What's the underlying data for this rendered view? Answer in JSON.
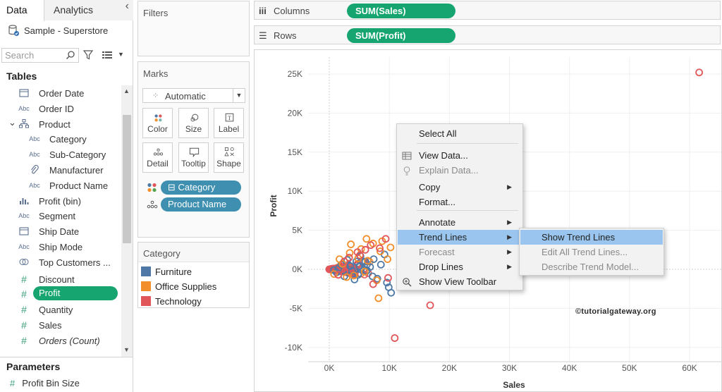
{
  "left_pane": {
    "tabs": {
      "data": "Data",
      "analytics": "Analytics"
    },
    "collapse_glyph": "‹",
    "datasource": "Sample - Superstore",
    "search": {
      "placeholder": "Search"
    },
    "tables_title": "Tables",
    "fields": [
      {
        "icon": "calendar-icon",
        "label": "Order Date"
      },
      {
        "icon": "abc-icon",
        "label": "Order ID"
      },
      {
        "icon": "hierarchy-icon",
        "label": "Product"
      },
      {
        "icon": "abc-icon",
        "label": "Category"
      },
      {
        "icon": "abc-icon",
        "label": "Sub-Category"
      },
      {
        "icon": "paperclip-icon",
        "label": "Manufacturer"
      },
      {
        "icon": "abc-icon",
        "label": "Product Name"
      },
      {
        "icon": "bin-chart-icon",
        "label": "Profit (bin)"
      },
      {
        "icon": "abc-icon",
        "label": "Segment"
      },
      {
        "icon": "calendar-icon",
        "label": "Ship Date"
      },
      {
        "icon": "abc-icon",
        "label": "Ship Mode"
      },
      {
        "icon": "set-icon",
        "label": "Top Customers ..."
      },
      {
        "icon": "hash-icon",
        "label": "Discount"
      },
      {
        "icon": "hash-icon",
        "label": "Profit"
      },
      {
        "icon": "hash-icon",
        "label": "Quantity"
      },
      {
        "icon": "hash-icon",
        "label": "Sales"
      },
      {
        "icon": "hash-icon",
        "label": "Orders (Count)"
      }
    ],
    "abc_text": "Abc",
    "parameters_title": "Parameters",
    "parameters": [
      {
        "icon": "hash-icon",
        "label": "Profit Bin Size"
      }
    ]
  },
  "filters_card": {
    "title": "Filters"
  },
  "marks_card": {
    "title": "Marks",
    "mark_type": "Automatic",
    "buttons": {
      "color": "Color",
      "size": "Size",
      "label": "Label",
      "detail": "Detail",
      "tooltip": "Tooltip",
      "shape": "Shape"
    },
    "pills": [
      {
        "label": "Category",
        "encoding": "color"
      },
      {
        "label": "Product Name",
        "encoding": "detail"
      }
    ]
  },
  "category_legend": {
    "title": "Category",
    "items": [
      {
        "label": "Furniture",
        "color": "#4e79a7"
      },
      {
        "label": "Office Supplies",
        "color": "#f28e2b"
      },
      {
        "label": "Technology",
        "color": "#e15759"
      }
    ]
  },
  "shelves": {
    "columns": {
      "label": "Columns",
      "pill": "SUM(Sales)"
    },
    "rows": {
      "label": "Rows",
      "pill": "SUM(Profit)"
    }
  },
  "chart_data": {
    "type": "scatter",
    "title": "",
    "xlabel": "Sales",
    "ylabel": "Profit",
    "xlim": [
      -4000,
      66000
    ],
    "ylim": [
      -11500,
      27000
    ],
    "x_ticks": [
      "0K",
      "10K",
      "20K",
      "30K",
      "40K",
      "50K",
      "60K"
    ],
    "y_ticks": [
      "-10K",
      "-5K",
      "0K",
      "5K",
      "10K",
      "15K",
      "20K",
      "25K"
    ],
    "x_tick_values": [
      0,
      10000,
      20000,
      30000,
      40000,
      50000,
      60000
    ],
    "y_tick_values": [
      -10000,
      -5000,
      0,
      5000,
      10000,
      15000,
      20000,
      25000
    ],
    "grid": true,
    "series": [
      {
        "name": "Furniture",
        "color": "#4e79a7",
        "points": [
          [
            1200,
            -400
          ],
          [
            2500,
            -900
          ],
          [
            3500,
            400
          ],
          [
            4800,
            -700
          ],
          [
            5600,
            900
          ],
          [
            6200,
            -200
          ],
          [
            7400,
            1300
          ],
          [
            8000,
            -1200
          ],
          [
            8600,
            600
          ],
          [
            9200,
            1900
          ],
          [
            9600,
            -1700
          ],
          [
            9900,
            -2300
          ],
          [
            10300,
            -3000
          ],
          [
            3000,
            1200
          ],
          [
            4200,
            -1300
          ],
          [
            5200,
            1700
          ],
          [
            6800,
            300
          ],
          [
            7200,
            -900
          ],
          [
            2000,
            600
          ],
          [
            1500,
            100
          ],
          [
            800,
            -100
          ],
          [
            3800,
            -200
          ],
          [
            5000,
            400
          ],
          [
            6000,
            1000
          ],
          [
            4500,
            1000
          ]
        ]
      },
      {
        "name": "Office Supplies",
        "color": "#f28e2b",
        "points": [
          [
            800,
            -600
          ],
          [
            2200,
            700
          ],
          [
            3400,
            2100
          ],
          [
            4100,
            -800
          ],
          [
            5300,
            2600
          ],
          [
            6400,
            1100
          ],
          [
            7300,
            3300
          ],
          [
            7900,
            -1400
          ],
          [
            8500,
            2300
          ],
          [
            8200,
            -3700
          ],
          [
            9700,
            1300
          ],
          [
            10200,
            2800
          ],
          [
            3600,
            3200
          ],
          [
            6200,
            3900
          ],
          [
            8800,
            3600
          ],
          [
            4800,
            1400
          ],
          [
            5900,
            -300
          ],
          [
            2900,
            -1000
          ],
          [
            1700,
            1300
          ]
        ]
      },
      {
        "name": "Technology",
        "color": "#e15759",
        "points": [
          [
            1500,
            -700
          ],
          [
            3300,
            1500
          ],
          [
            4700,
            2200
          ],
          [
            6900,
            3100
          ],
          [
            8400,
            2700
          ],
          [
            9400,
            3900
          ],
          [
            16800,
            -4600
          ],
          [
            10900,
            -8800
          ],
          [
            61600,
            25200
          ],
          [
            7300,
            -1900
          ],
          [
            5100,
            1800
          ],
          [
            2500,
            1000
          ],
          [
            9800,
            -1100
          ],
          [
            6000,
            2500
          ]
        ]
      }
    ]
  },
  "watermark": "©tutorialgateway.org",
  "context_menu": {
    "items": [
      {
        "label": "Select All",
        "icon": "",
        "disabled": false,
        "submenu": false
      },
      {
        "label": "View Data...",
        "icon": "table-icon",
        "disabled": false,
        "submenu": false
      },
      {
        "label": "Explain Data...",
        "icon": "lightbulb-icon",
        "disabled": true,
        "submenu": false
      },
      {
        "label": "Copy",
        "icon": "",
        "disabled": false,
        "submenu": true
      },
      {
        "label": "Format...",
        "icon": "",
        "disabled": false,
        "submenu": false
      },
      {
        "label": "Annotate",
        "icon": "",
        "disabled": false,
        "submenu": true
      },
      {
        "label": "Trend Lines",
        "icon": "",
        "disabled": false,
        "submenu": true,
        "highlighted": true
      },
      {
        "label": "Forecast",
        "icon": "",
        "disabled": true,
        "submenu": true
      },
      {
        "label": "Drop Lines",
        "icon": "",
        "disabled": false,
        "submenu": true
      },
      {
        "label": "Show View Toolbar",
        "icon": "zoom-icon",
        "disabled": false,
        "submenu": false
      }
    ],
    "submenu": [
      {
        "label": "Show Trend Lines",
        "disabled": false,
        "highlighted": true
      },
      {
        "label": "Edit All Trend Lines...",
        "disabled": true
      },
      {
        "label": "Describe Trend Model...",
        "disabled": true
      }
    ]
  },
  "colors": {
    "accent_green": "#16a571",
    "dim_pill_blue": "#3e8fb0",
    "menu_highlight": "#99c5ee"
  }
}
